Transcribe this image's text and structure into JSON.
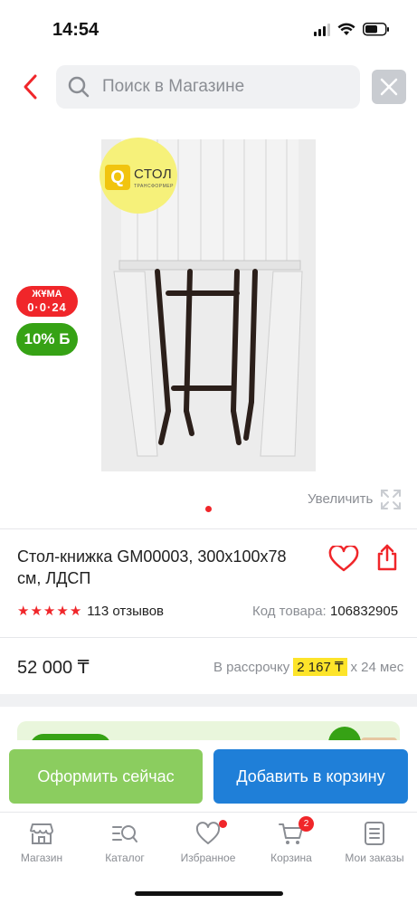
{
  "status_bar": {
    "time": "14:54"
  },
  "search": {
    "placeholder": "Поиск в Магазине"
  },
  "gallery": {
    "brand_logo_text": "СТОЛ",
    "brand_logo_subtext": "ТРАНСФОРМЕР",
    "badge_friday_top": "ЖҰМА",
    "badge_friday_timer": "0·0·24",
    "badge_discount": "10% Б",
    "zoom_label": "Увеличить"
  },
  "product": {
    "title": "Стол-книжка GM00003, 300x100x78 см, ЛДСП",
    "rating": 5,
    "reviews": "113 отзывов",
    "sku_label": "Код товара:",
    "sku_value": "106832905"
  },
  "price": {
    "value": "52 000 ₸",
    "installment_prefix": "В рассрочку",
    "installment_amount": "2 167 ₸",
    "installment_suffix": "х 24 мес"
  },
  "actions": {
    "order_now": "Оформить сейчас",
    "add_to_cart": "Добавить в корзину"
  },
  "bottom_nav": {
    "items": [
      {
        "label": "Магазин",
        "icon": "shop-icon"
      },
      {
        "label": "Каталог",
        "icon": "catalog-search-icon"
      },
      {
        "label": "Избранное",
        "icon": "heart-icon"
      },
      {
        "label": "Корзина",
        "icon": "cart-icon",
        "badge": "2"
      },
      {
        "label": "Мои заказы",
        "icon": "orders-icon"
      }
    ]
  },
  "colors": {
    "accent_red": "#f0262a",
    "order_green": "#8bcd5f",
    "cart_blue": "#1f7fd8",
    "installment_yellow": "#fde42a"
  }
}
